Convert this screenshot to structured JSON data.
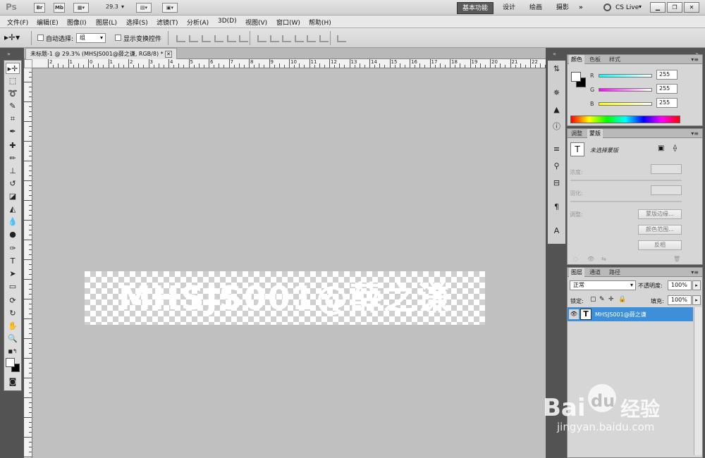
{
  "app": {
    "logo": "Ps"
  },
  "appbar": {
    "br_label": "Br",
    "mb_label": "Mb",
    "zoom_value": "29.3",
    "workspaces": [
      "基本功能",
      "设计",
      "绘画",
      "摄影"
    ],
    "more": "»",
    "cs_live": "CS Live"
  },
  "menu": {
    "items": [
      "文件(F)",
      "编辑(E)",
      "图像(I)",
      "图层(L)",
      "选择(S)",
      "滤镜(T)",
      "分析(A)",
      "3D(D)",
      "视图(V)",
      "窗口(W)",
      "帮助(H)"
    ]
  },
  "options": {
    "auto_select_label": "自动选择:",
    "auto_select_value": "组",
    "show_transform_label": "显示变换控件"
  },
  "document": {
    "tab_title": "未标题-1 @ 29.3% (MHSJS001@薛之谦, RGB/8) *",
    "layer_text": "MHSJS001@薛之谦",
    "ruler_numbers": [
      "2",
      "1",
      "0",
      "1",
      "2",
      "3",
      "4",
      "5",
      "6",
      "7",
      "8",
      "9",
      "10",
      "11",
      "12",
      "13",
      "14",
      "15",
      "16",
      "17",
      "18",
      "19",
      "20",
      "21",
      "22",
      "23"
    ]
  },
  "color_panel": {
    "tabs": [
      "颜色",
      "色板",
      "样式"
    ],
    "r_label": "R",
    "g_label": "G",
    "b_label": "B",
    "r_value": "255",
    "g_value": "255",
    "b_value": "255"
  },
  "adjust_panel": {
    "tabs": [
      "调整",
      "蒙版"
    ],
    "status": "未选择蒙版",
    "density_label": "浓度:",
    "feather_label": "羽化:",
    "refine_label": "调整:",
    "mask_edge_btn": "蒙版边缘...",
    "color_range_btn": "颜色范围...",
    "invert_btn": "反相"
  },
  "layers_panel": {
    "tabs": [
      "图层",
      "通道",
      "路径"
    ],
    "blend_mode": "正常",
    "opacity_label": "不透明度:",
    "opacity_value": "100%",
    "lock_label": "锁定:",
    "fill_label": "填充:",
    "fill_value": "100%",
    "layer_name": "MHSJS001@薛之谦",
    "layer_type_glyph": "T"
  },
  "watermark": {
    "brand": "Bai",
    "brand2": "du",
    "cn": "经验",
    "url": "jingyan.baidu.com"
  }
}
